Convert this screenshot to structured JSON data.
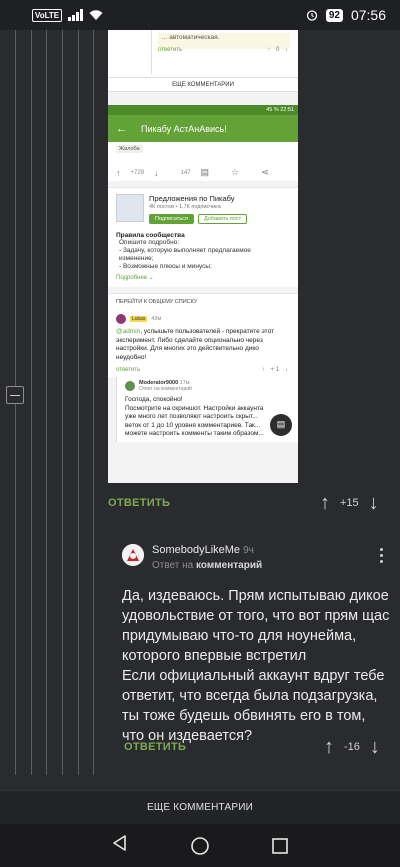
{
  "statusbar": {
    "volte": "VoLTE",
    "battery": "92",
    "time": "07:56"
  },
  "embed": {
    "top_note": "... автоматическая.",
    "top_reply": "ответить",
    "top_votes": "↑ 0 ↓",
    "more_comments": "ЕЩЕ КОММЕНТАРИИ",
    "phone_status": "45 % 22:51",
    "app_title": "Пикабу АстАнАвись!",
    "tag": "Жалоба",
    "post_votes": "+729",
    "post_comments": "147",
    "community_title": "Предложения по Пикабу",
    "community_sub": "4К постов • 1,7К подписчика",
    "subscribe": "Подписаться",
    "add_post": "Добавить пост",
    "rules_title": "Правила сообщества",
    "rules_lines": [
      "Опишите подробно:",
      "- Задачу, которую выполняет предлагаемое",
      "изменение;",
      "- Возможные плюсы и минусы;"
    ],
    "more_link": "Подробнее ⌄",
    "to_list": "ПЕРЕЙТИ К ОБЩЕМУ СПИСКУ",
    "cm_badge": "Lukas",
    "cm_time": "43м",
    "cm_mention": "@admin",
    "cm_text": ", услышьте пользователей - прекратите этот эксперимент. Либо сделайте опционально через настройки. Для многих это действительно дико неудобно!",
    "cm_reply": "ответить",
    "cm_votes": "↑ +1 ↓",
    "reply_name": "Moderator9000",
    "reply_time": "17м",
    "reply_sub": "Ответ на комментарий",
    "reply_lines": [
      "Господа, спокойно!",
      "Посмотрите на скриншот. Настройки аккаунта",
      "уже много лет позволяют настроить скрыт...",
      "веток от 1 до 10 уровня комментариев. Так...",
      "можете настроить комменты таким образом..."
    ]
  },
  "comment1_footer": {
    "reply": "ОТВЕТИТЬ",
    "votes": "+15"
  },
  "comment2": {
    "author": "SomebodyLikeMe",
    "time": "9ч",
    "reply_prefix": "Ответ на",
    "reply_target": "комментарий",
    "text": "Да, издеваюсь. Прям испытываю дикое удовольствие от того, что вот прям щас придумываю что-то для ноунейма, которого впервые встретил\nЕсли официальный аккаунт вдруг тебе ответит, что всегда была подзагрузка, ты тоже будешь обвинять его в том, что он издевается?",
    "reply": "ОТВЕТИТЬ",
    "votes": "-16"
  },
  "more_comments_bar": "ЕЩЕ КОММЕНТАРИИ",
  "colors": {
    "accent": "#7dac4c",
    "bg": "#2a2b2e",
    "pikabu_green": "#62a236"
  }
}
